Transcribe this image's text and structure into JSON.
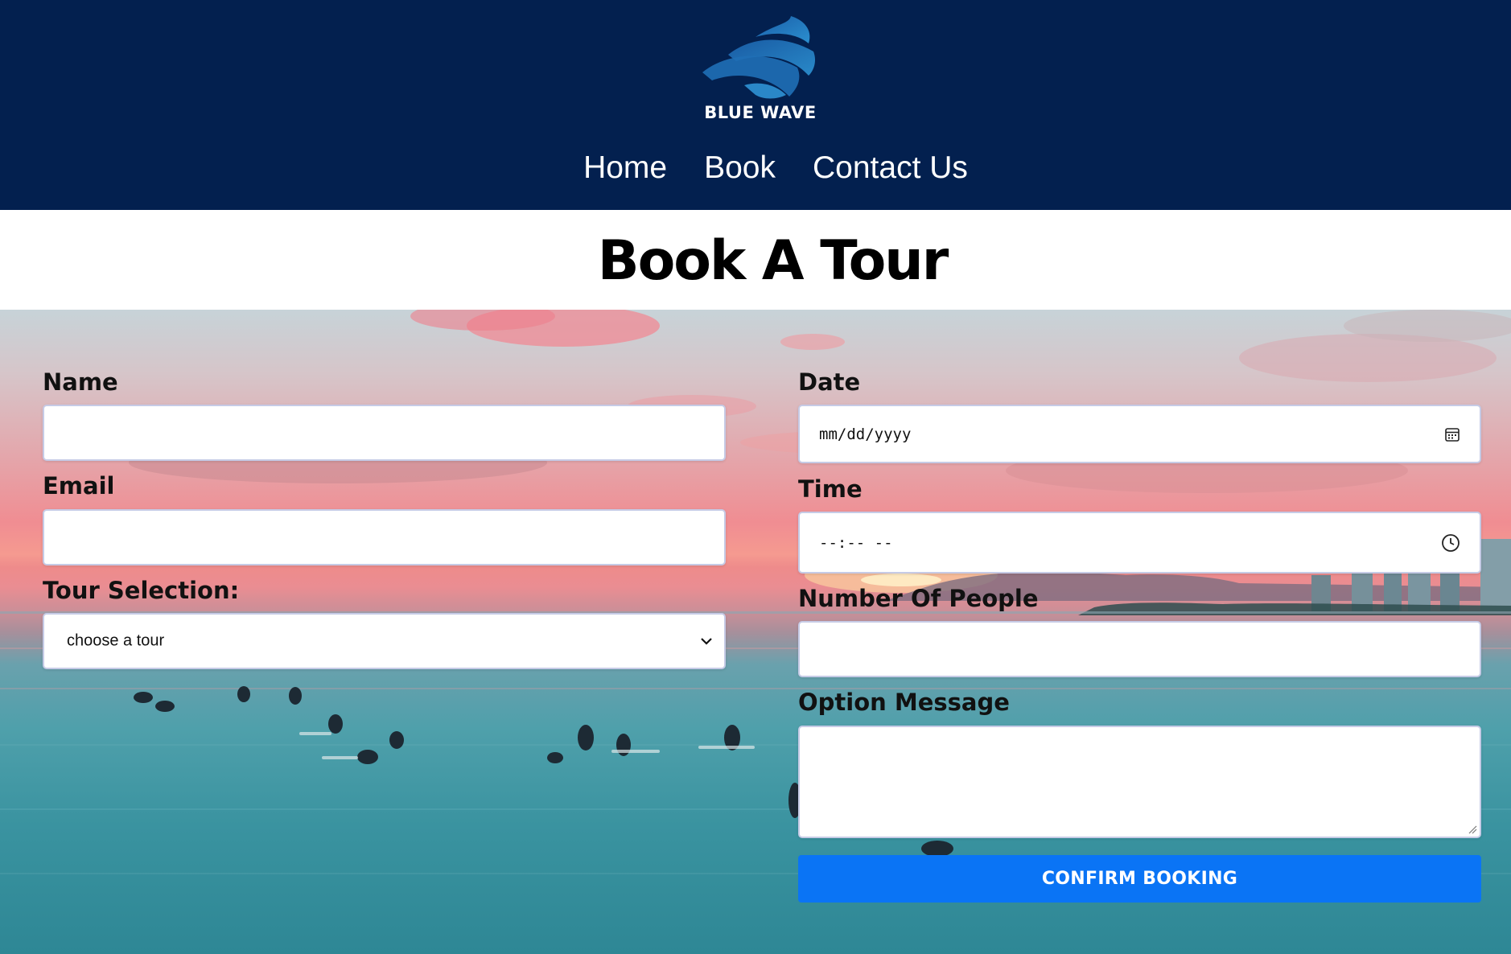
{
  "header": {
    "brand": "BLUE WAVE",
    "nav": [
      {
        "label": "Home"
      },
      {
        "label": "Book"
      },
      {
        "label": "Contact Us"
      }
    ]
  },
  "page": {
    "title": "Book A Tour"
  },
  "form": {
    "name": {
      "label": "Name",
      "value": ""
    },
    "email": {
      "label": "Email",
      "value": ""
    },
    "tour": {
      "label": "Tour Selection:",
      "selected": "choose a tour"
    },
    "date": {
      "label": "Date",
      "placeholder": "mm/dd/yyyy"
    },
    "time": {
      "label": "Time",
      "placeholder": "--:-- --"
    },
    "people": {
      "label": "Number Of People",
      "value": ""
    },
    "message": {
      "label": "Option Message",
      "value": ""
    },
    "submit_label": "CONFIRM BOOKING"
  },
  "icons": {
    "logo": "wave-logo-icon",
    "date": "calendar-icon",
    "time": "clock-icon",
    "select": "chevron-down-icon"
  },
  "colors": {
    "header_bg": "#03204f",
    "button_bg": "#0a74f5",
    "text": "#111111",
    "input_border": "#c6cbe6"
  }
}
